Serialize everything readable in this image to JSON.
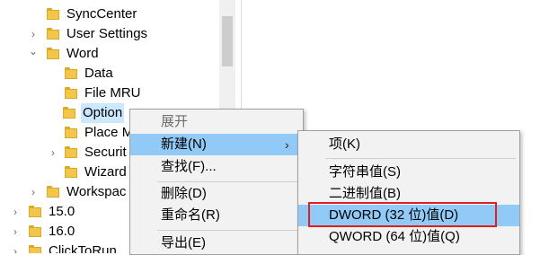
{
  "tree": {
    "items": [
      {
        "label": "SyncCenter",
        "chevron": ""
      },
      {
        "label": "User Settings",
        "chevron": "›"
      },
      {
        "label": "Word",
        "chevron": "⌄"
      },
      {
        "label": "Data",
        "chevron": ""
      },
      {
        "label": "File MRU",
        "chevron": ""
      },
      {
        "label": "Option",
        "chevron": ""
      },
      {
        "label": "Place M",
        "chevron": ""
      },
      {
        "label": "Securit",
        "chevron": "›"
      },
      {
        "label": "Wizard",
        "chevron": ""
      },
      {
        "label": "Workspac",
        "chevron": "›"
      },
      {
        "label": "15.0",
        "chevron": "›"
      },
      {
        "label": "16.0",
        "chevron": "›"
      },
      {
        "label": "ClickToRun",
        "chevron": "›"
      }
    ]
  },
  "context_menu": {
    "items": [
      {
        "label": "展开",
        "disabled": true
      },
      {
        "label": "新建(N)",
        "highlight": true,
        "arrow": "›"
      },
      {
        "label": "查找(F)..."
      },
      {
        "label": "删除(D)"
      },
      {
        "label": "重命名(R)"
      },
      {
        "label": "导出(E)"
      }
    ]
  },
  "submenu": {
    "items": [
      {
        "label": "项(K)"
      },
      {
        "label": "字符串值(S)"
      },
      {
        "label": "二进制值(B)"
      },
      {
        "label": "DWORD (32 位)值(D)",
        "highlight": true,
        "boxed": true
      },
      {
        "label": "QWORD (64 位)值(Q)"
      }
    ]
  },
  "colors": {
    "highlight": "#91c9f7",
    "boxed_outline": "#e02020",
    "folder": "#f2c54b"
  }
}
